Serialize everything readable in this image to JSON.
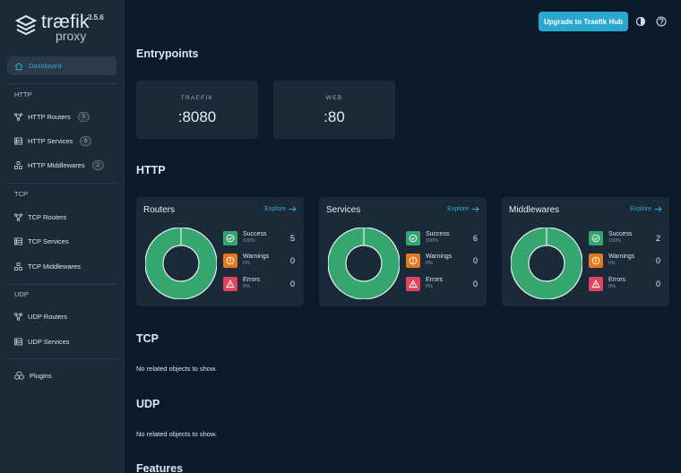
{
  "brand": {
    "name": "træfik",
    "sub": "proxy",
    "version": "3.5.6"
  },
  "sidebar": {
    "dashboard": "Dashboard",
    "http": {
      "title": "HTTP",
      "items": [
        {
          "label": "HTTP Routers",
          "count": "5"
        },
        {
          "label": "HTTP Services",
          "count": "6"
        },
        {
          "label": "HTTP Middlewares",
          "count": "2"
        }
      ]
    },
    "tcp": {
      "title": "TCP",
      "items": [
        {
          "label": "TCP Routers"
        },
        {
          "label": "TCP Services"
        },
        {
          "label": "TCP Middlewares"
        }
      ]
    },
    "udp": {
      "title": "UDP",
      "items": [
        {
          "label": "UDP Routers"
        },
        {
          "label": "UDP Services"
        }
      ]
    },
    "plugins": "Plugins"
  },
  "header": {
    "upgrade": "Upgrade to Traefik Hub",
    "theme_icon": "contrast-icon",
    "help_icon": "help-icon"
  },
  "entrypoints": {
    "title": "Entrypoints",
    "items": [
      {
        "name": "TRAEFIK",
        "port": ":8080"
      },
      {
        "name": "WEB",
        "port": ":80"
      }
    ]
  },
  "http": {
    "title": "HTTP",
    "cards": [
      {
        "title": "Routers",
        "explore": "Explore",
        "success": {
          "label": "Success",
          "pct": "100%",
          "value": "5"
        },
        "warnings": {
          "label": "Warnings",
          "pct": "0%",
          "value": "0"
        },
        "errors": {
          "label": "Errors",
          "pct": "0%",
          "value": "0"
        }
      },
      {
        "title": "Services",
        "explore": "Explore",
        "success": {
          "label": "Success",
          "pct": "100%",
          "value": "6"
        },
        "warnings": {
          "label": "Warnings",
          "pct": "0%",
          "value": "0"
        },
        "errors": {
          "label": "Errors",
          "pct": "0%",
          "value": "0"
        }
      },
      {
        "title": "Middlewares",
        "explore": "Explore",
        "success": {
          "label": "Success",
          "pct": "100%",
          "value": "2"
        },
        "warnings": {
          "label": "Warnings",
          "pct": "0%",
          "value": "0"
        },
        "errors": {
          "label": "Errors",
          "pct": "0%",
          "value": "0"
        }
      }
    ]
  },
  "tcp": {
    "title": "TCP",
    "empty": "No related objects to show."
  },
  "udp": {
    "title": "UDP",
    "empty": "No related objects to show."
  },
  "features": {
    "title": "Features"
  },
  "colors": {
    "accent": "#2ea8d5",
    "success": "#35a66f",
    "warning": "#e8781e",
    "error": "#e0445f",
    "bg": "#0b1a2b",
    "panel": "#1b2a38"
  }
}
